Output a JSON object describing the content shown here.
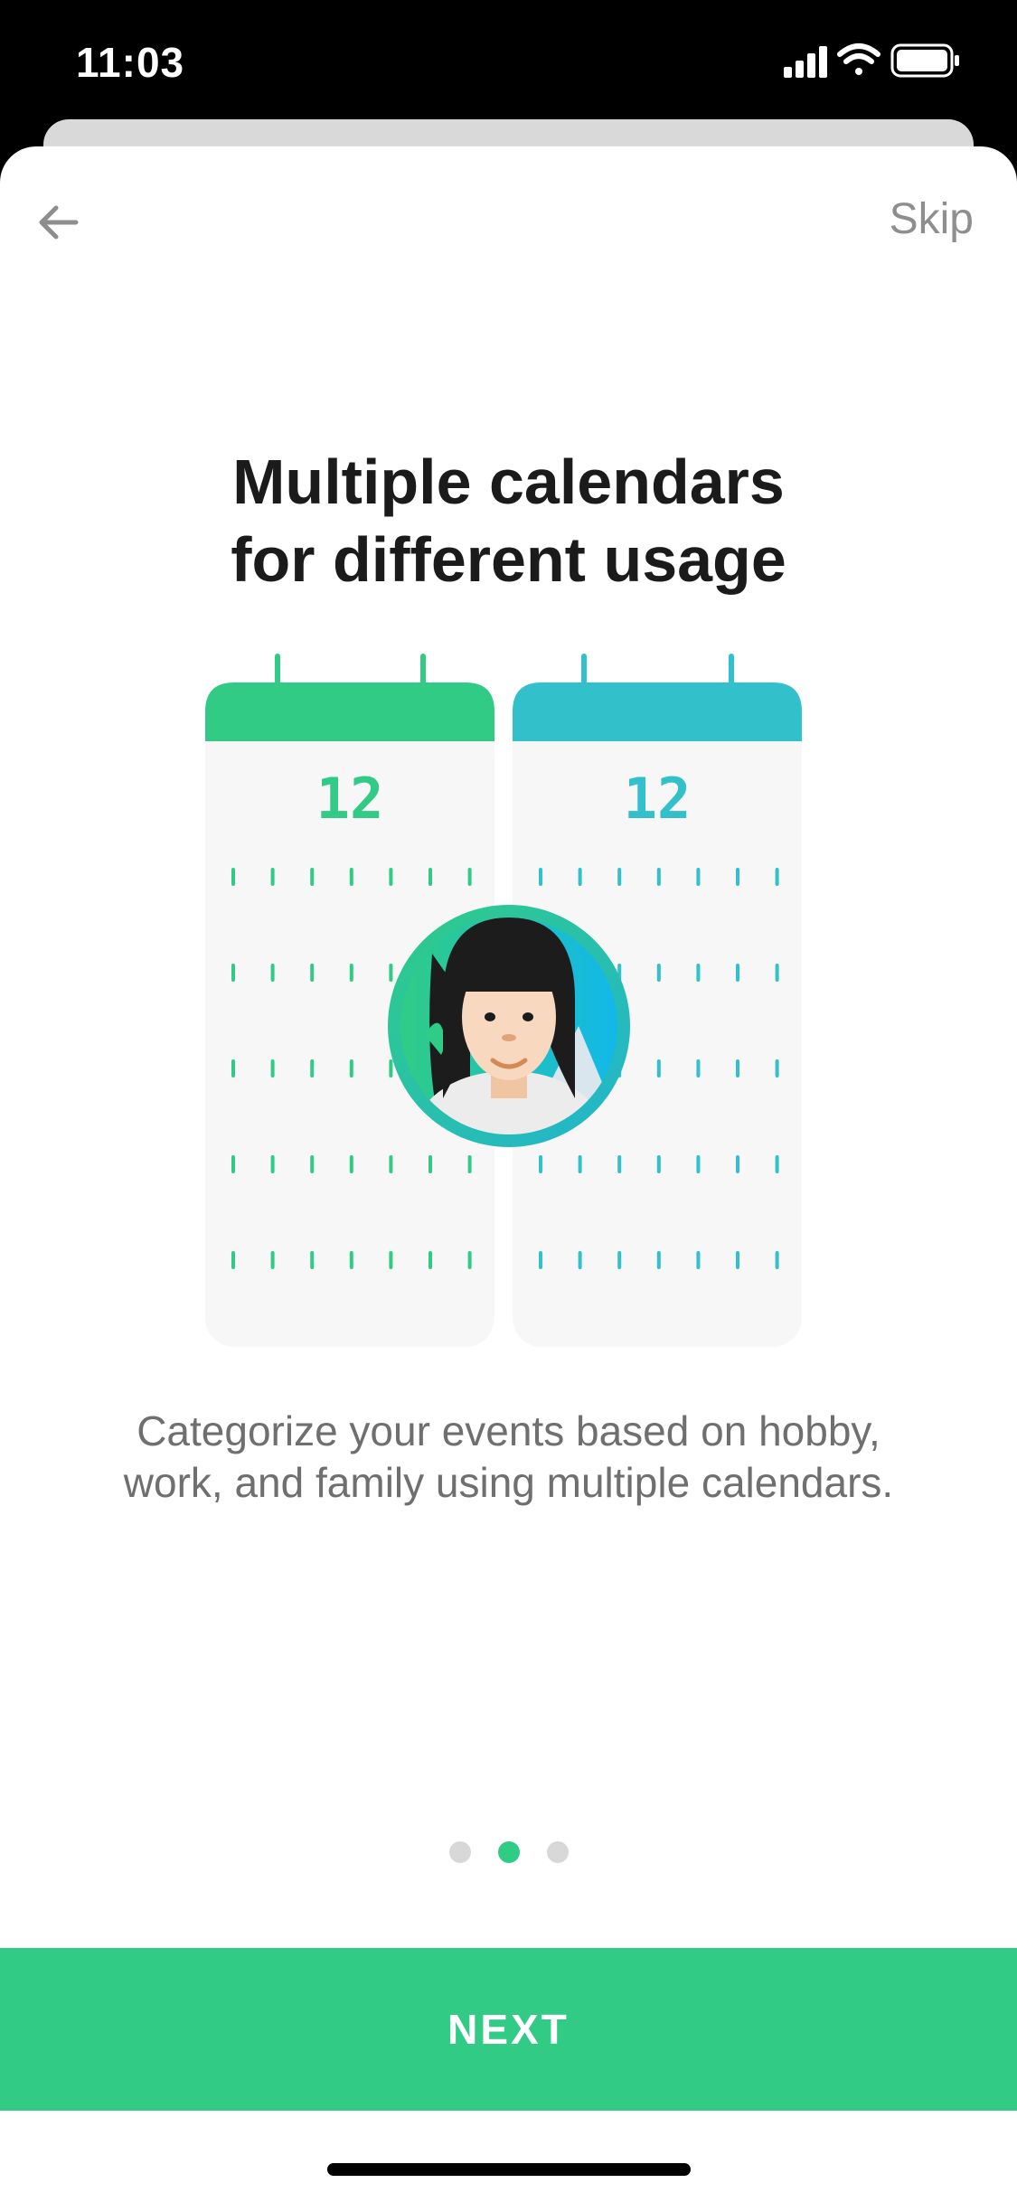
{
  "status_bar": {
    "time": "11:03",
    "icons": [
      "signal-icon",
      "wifi-icon",
      "battery-icon"
    ]
  },
  "header": {
    "back_icon": "arrow-left-icon",
    "skip_label": "Skip"
  },
  "onboarding": {
    "title_line1": "Multiple calendars",
    "title_line2": "for different usage",
    "calendar_left": {
      "day": "12",
      "color": "#32cb85"
    },
    "calendar_right": {
      "day": "12",
      "color": "#32c0cb"
    },
    "avatar_icon": "user-avatar-icon",
    "description": "Categorize your events based on hobby, work, and family using multiple calendars.",
    "page_count": 3,
    "active_page": 2
  },
  "footer": {
    "next_label": "NEXT"
  },
  "colors": {
    "accent": "#32cb85",
    "teal": "#32c0cb",
    "title_text": "#1b1b1b",
    "body_text": "#6f6f6f"
  }
}
